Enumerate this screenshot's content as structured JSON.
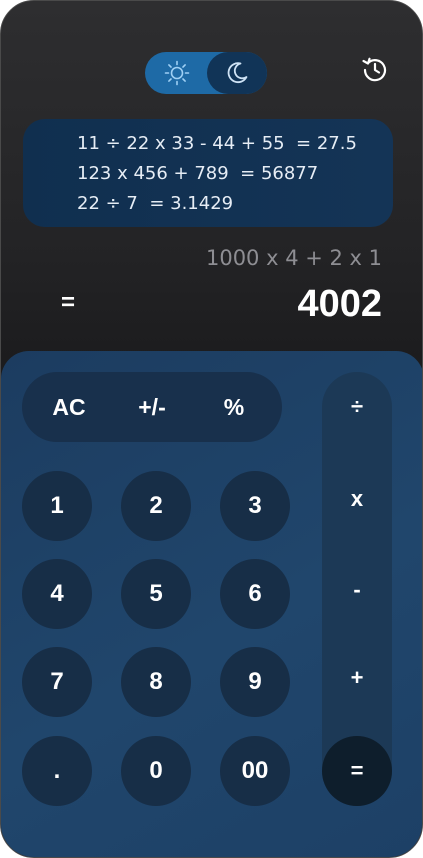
{
  "header": {
    "theme_toggle": {
      "light_icon": "sun-icon",
      "dark_icon": "moon-icon",
      "selected": "dark"
    },
    "history_icon": "history-icon"
  },
  "history": [
    "11 ÷ 22 x 33 - 44 + 55  = 27.5",
    "123 x 456 + 789  = 56877",
    "22 ÷ 7  = 3.1429"
  ],
  "display": {
    "expression": "1000 x 4 + 2 x 1",
    "equals": "=",
    "result": "4002"
  },
  "keypad": {
    "functions": [
      "AC",
      "+/-",
      "%"
    ],
    "operators": [
      "÷",
      "x",
      "-",
      "+",
      "="
    ],
    "digits": [
      "1",
      "2",
      "3",
      "4",
      "5",
      "6",
      "7",
      "8",
      "9",
      ".",
      "0",
      "00"
    ]
  },
  "colors": {
    "toggle_bg": "#1e6aa6",
    "toggle_active": "#113457",
    "history_bg": "#102f4f",
    "keypad_bg": "#1f436a",
    "key_bg": "#172e47"
  }
}
